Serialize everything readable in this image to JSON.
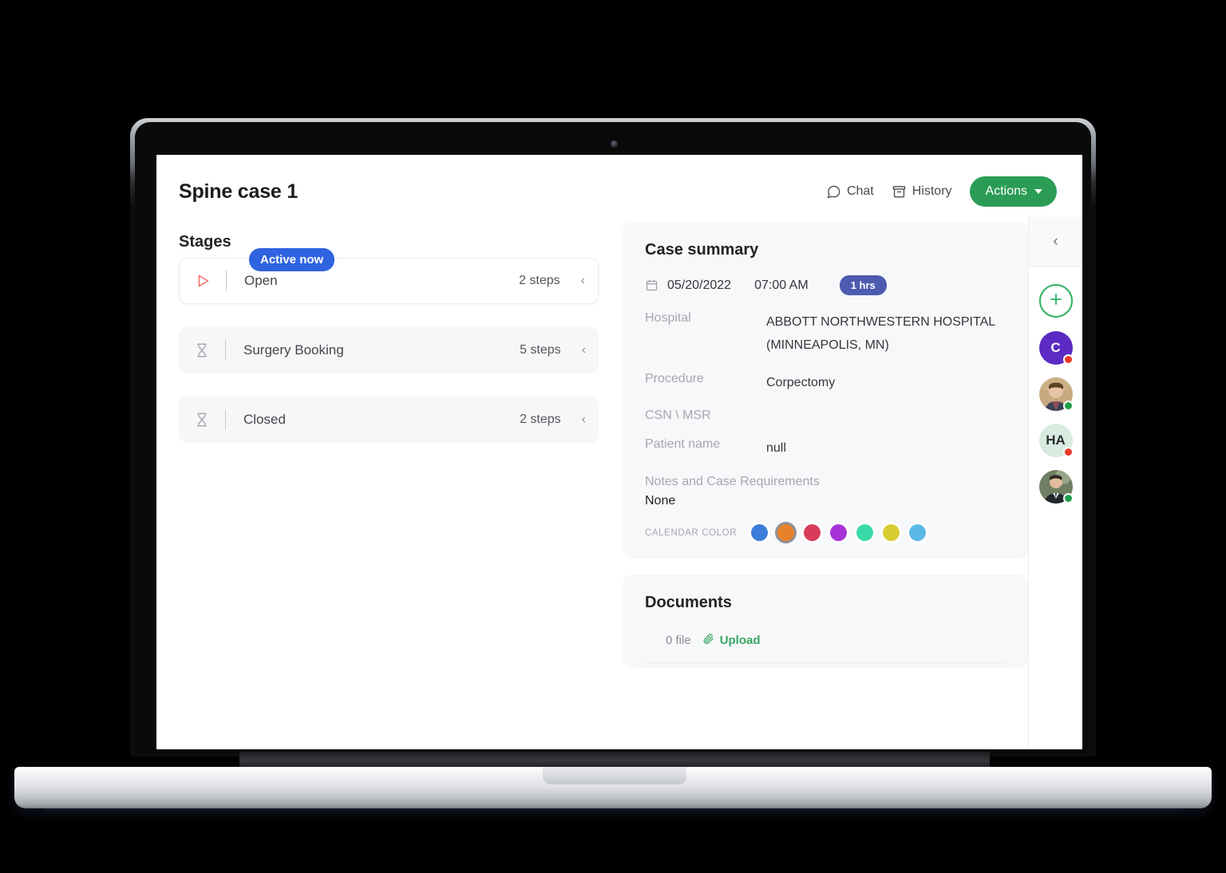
{
  "header": {
    "title": "Spine case 1",
    "chat_label": "Chat",
    "history_label": "History",
    "actions_label": "Actions"
  },
  "stages": {
    "section_title": "Stages",
    "active_badge": "Active now",
    "items": [
      {
        "name": "Open",
        "steps": "2 steps",
        "icon": "play-icon",
        "state": "active"
      },
      {
        "name": "Surgery Booking",
        "steps": "5 steps",
        "icon": "hourglass-icon",
        "state": "idle"
      },
      {
        "name": "Closed",
        "steps": "2 steps",
        "icon": "hourglass-icon",
        "state": "idle"
      }
    ]
  },
  "case_summary": {
    "title": "Case summary",
    "date": "05/20/2022",
    "time": "07:00 AM",
    "duration_badge": "1 hrs",
    "fields": [
      {
        "key": "Hospital",
        "value": "ABBOTT NORTHWESTERN HOSPITAL (MINNEAPOLIS, MN)"
      },
      {
        "key": "Procedure",
        "value": "Corpectomy"
      },
      {
        "key": "CSN \\ MSR",
        "value": ""
      },
      {
        "key": "Patient name",
        "value": "null"
      }
    ],
    "notes_label": "Notes and Case Requirements",
    "notes_value": "None",
    "calendar_color_label": "CALENDAR COLOR",
    "calendar_colors": [
      {
        "hex": "#3b7dd8",
        "selected": false
      },
      {
        "hex": "#e8822a",
        "selected": true
      },
      {
        "hex": "#d93b5c",
        "selected": false
      },
      {
        "hex": "#a833d6",
        "selected": false
      },
      {
        "hex": "#3ad9a8",
        "selected": false
      },
      {
        "hex": "#d9cc33",
        "selected": false
      },
      {
        "hex": "#5ab9e8",
        "selected": false
      }
    ]
  },
  "documents": {
    "title": "Documents",
    "file_count": "0 file",
    "upload_label": "Upload"
  },
  "right_rail": {
    "collapse_icon": "chevron-left-icon",
    "add_label": "+",
    "members": [
      {
        "type": "initials",
        "initials": "C",
        "bg": "#5b2bc4",
        "fg": "#ffffff",
        "status": "busy"
      },
      {
        "type": "photo",
        "bg": "#c8a882",
        "status": "online"
      },
      {
        "type": "initials",
        "initials": "HA",
        "bg": "#d9ebe0",
        "fg": "#2c2f33",
        "status": "busy"
      },
      {
        "type": "photo",
        "bg": "#5e6d58",
        "status": "online"
      }
    ]
  },
  "theme": {
    "accent_green": "#2b9c56",
    "accent_blue": "#2f63e0",
    "badge_indigo": "#4c5bb0",
    "play_coral": "#f0736a"
  }
}
